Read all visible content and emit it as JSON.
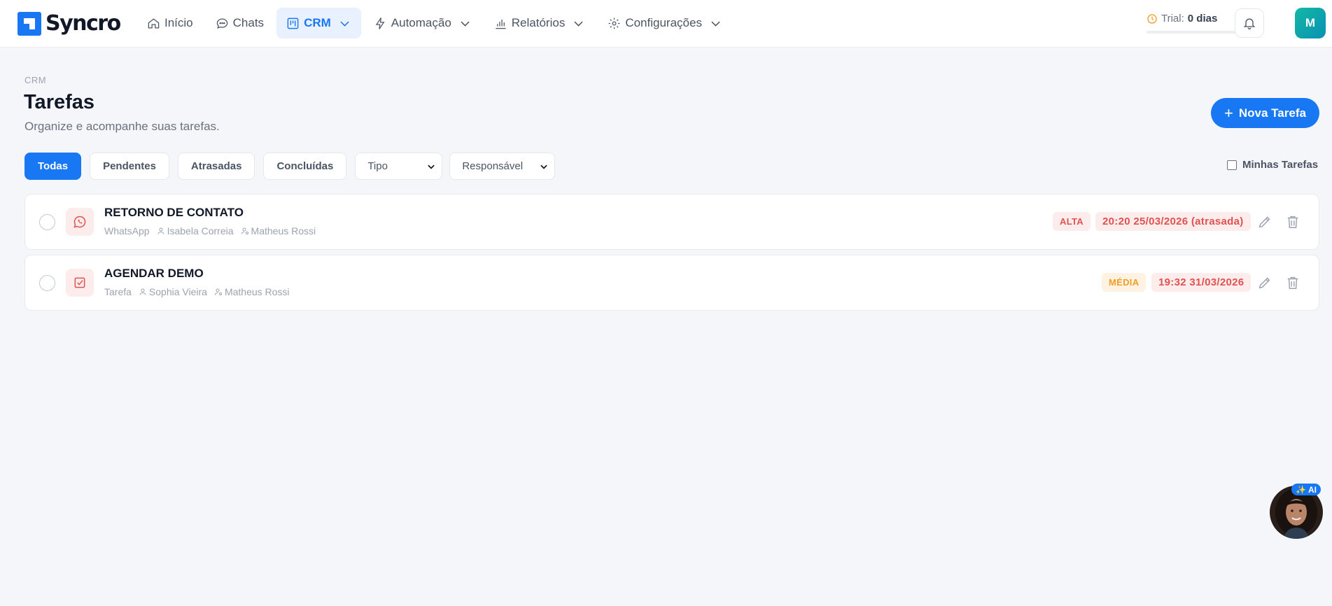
{
  "brand": {
    "name": "Syncro"
  },
  "nav": {
    "items": [
      {
        "label": "Início",
        "icon": "home-icon"
      },
      {
        "label": "Chats",
        "icon": "chat-icon"
      },
      {
        "label": "CRM",
        "icon": "kanban-icon"
      },
      {
        "label": "Automação",
        "icon": "lightning-icon"
      },
      {
        "label": "Relatórios",
        "icon": "bar-chart-icon"
      },
      {
        "label": "Configurações",
        "icon": "gear-icon"
      }
    ],
    "active": "CRM"
  },
  "trial": {
    "label": "Trial:",
    "value": "0 dias"
  },
  "user": {
    "initial": "M"
  },
  "header": {
    "breadcrumb": "CRM",
    "title": "Tarefas",
    "subtitle": "Organize e acompanhe suas tarefas.",
    "new_button": "Nova Tarefa"
  },
  "filters": {
    "tabs": [
      "Todas",
      "Pendentes",
      "Atrasadas",
      "Concluídas"
    ],
    "active": "Todas",
    "type_select": "Tipo",
    "owner_select": "Responsável",
    "mine_label": "Minhas Tarefas"
  },
  "tasks": [
    {
      "title": "RETORNO DE CONTATO",
      "type": "WhatsApp",
      "contact": "Isabela Correia",
      "owner": "Matheus Rossi",
      "priority": "ALTA",
      "due": "20:20 25/03/2026 (atrasada)",
      "icon": "whatsapp-icon"
    },
    {
      "title": "AGENDAR DEMO",
      "type": "Tarefa",
      "contact": "Sophia Vieira",
      "owner": "Matheus Rossi",
      "priority": "MÉDIA",
      "due": "19:32 31/03/2026",
      "icon": "checkbox-task-icon"
    }
  ],
  "assistant": {
    "badge": "AI"
  },
  "colors": {
    "primary": "#1877f2",
    "danger": "#e05252",
    "warning": "#f29d26"
  }
}
